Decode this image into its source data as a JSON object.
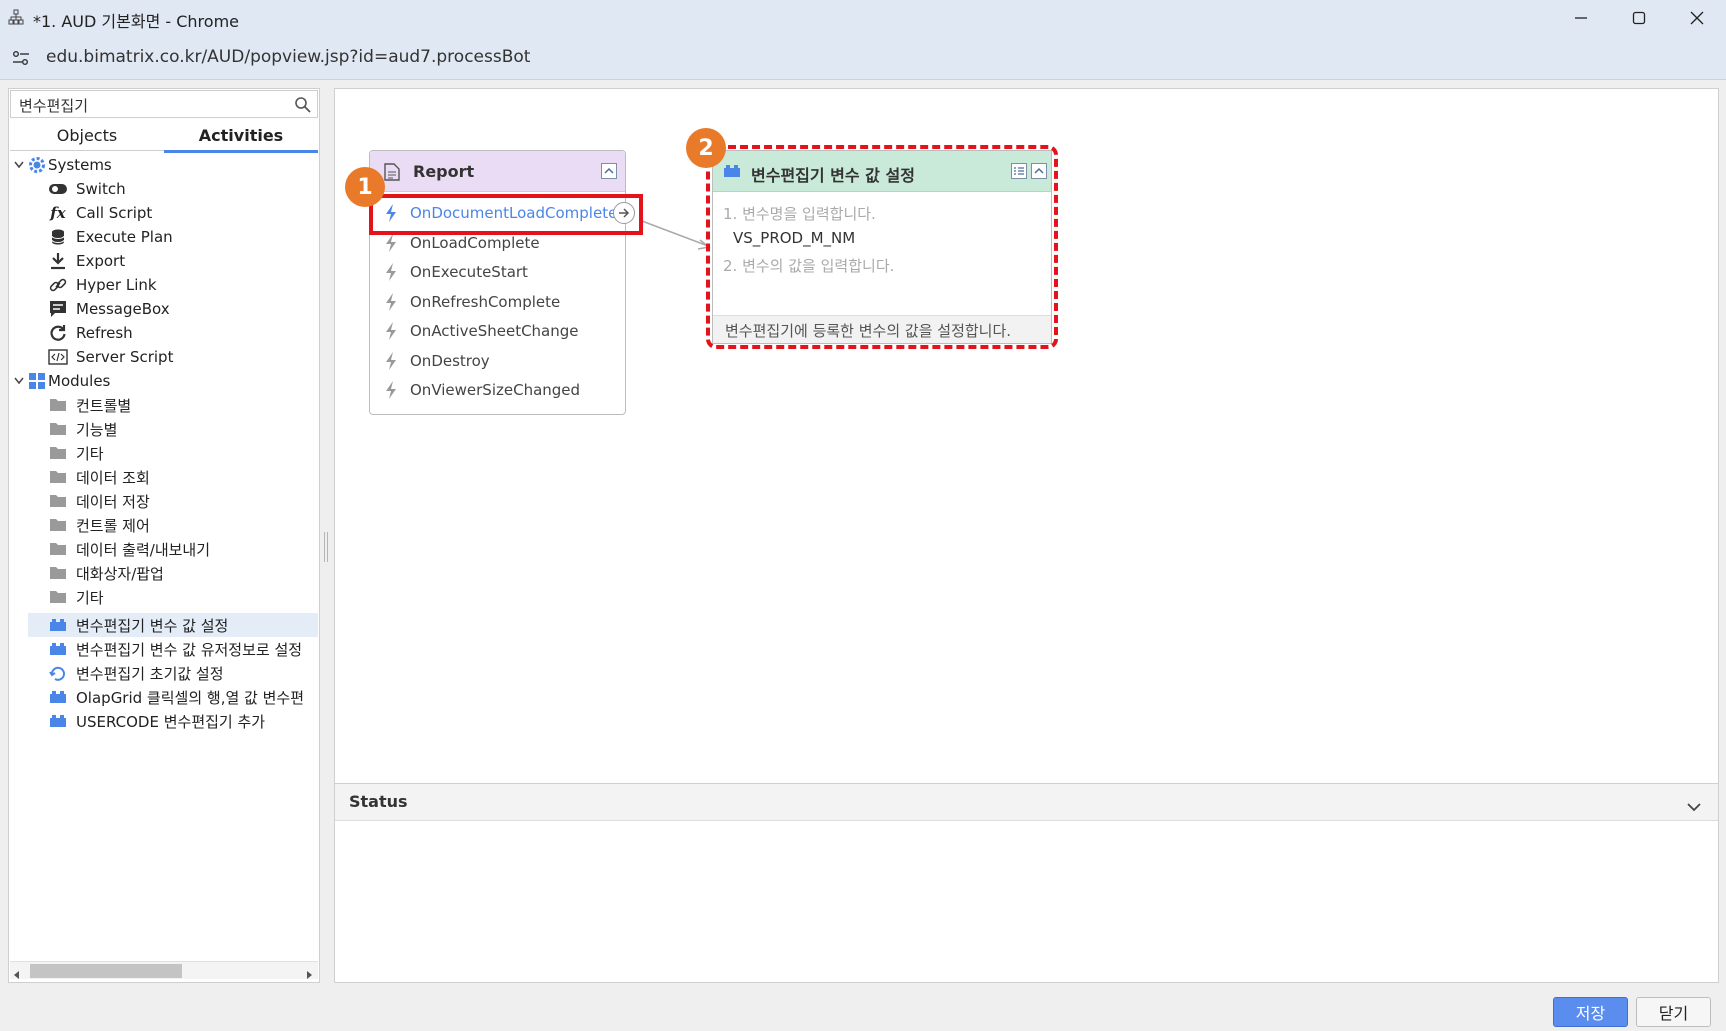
{
  "window": {
    "title": "*1. AUD 기본화면 - Chrome",
    "url": "edu.bimatrix.co.kr/AUD/popview.jsp?id=aud7.processBot"
  },
  "sidebar": {
    "search_value": "변수편집기",
    "tabs": [
      "Objects",
      "Activities"
    ],
    "active_tab": "Activities",
    "systems_label": "Systems",
    "system_items": [
      "Switch",
      "Call Script",
      "Execute Plan",
      "Export",
      "Hyper Link",
      "MessageBox",
      "Refresh",
      "Server Script"
    ],
    "modules_label": "Modules",
    "module_folders": [
      "컨트롤별",
      "기능별",
      "기타",
      "데이터 조회",
      "데이터 저장",
      "컨트롤 제어",
      "데이터 출력/내보내기",
      "대화상자/팝업",
      "기타"
    ],
    "module_items": [
      "변수편집기 변수 값 설정",
      "변수편집기 변수 값 유저정보로 설정",
      "변수편집기 초기값 설정",
      "OlapGrid 클릭셀의 행,열 값 변수편",
      "USERCODE 변수편집기 추가"
    ],
    "selected_item": "변수편집기 변수 값 설정"
  },
  "report_node": {
    "title": "Report",
    "events": [
      "OnDocumentLoadComplete",
      "OnLoadComplete",
      "OnExecuteStart",
      "OnRefreshComplete",
      "OnActiveSheetChange",
      "OnDestroy",
      "OnViewerSizeChanged"
    ],
    "active_event": "OnDocumentLoadComplete"
  },
  "activity_node": {
    "title": "변수편집기 변수 값 설정",
    "step1_hint": "1. 변수명을 입력합니다.",
    "step1_value": "VS_PROD_M_NM",
    "step2_hint": "2. 변수의 값을 입력합니다.",
    "description": "변수편집기에 등록한 변수의 값을 설정합니다."
  },
  "badges": {
    "one": "1",
    "two": "2"
  },
  "status_panel": {
    "title": "Status"
  },
  "buttons": {
    "save": "저장",
    "close": "닫기"
  },
  "colors": {
    "accent": "#4a86e8",
    "highlight": "#e3121b",
    "badge": "#e87a2a",
    "report_header": "#eadcf4",
    "activity_header": "#c9ead9"
  },
  "icons": {
    "switch": "toggle-icon",
    "call_script": "fx-icon",
    "execute_plan": "database-icon",
    "export": "download-icon",
    "hyper_link": "link-icon",
    "messagebox": "message-icon",
    "refresh": "refresh-icon",
    "server_script": "code-icon"
  }
}
